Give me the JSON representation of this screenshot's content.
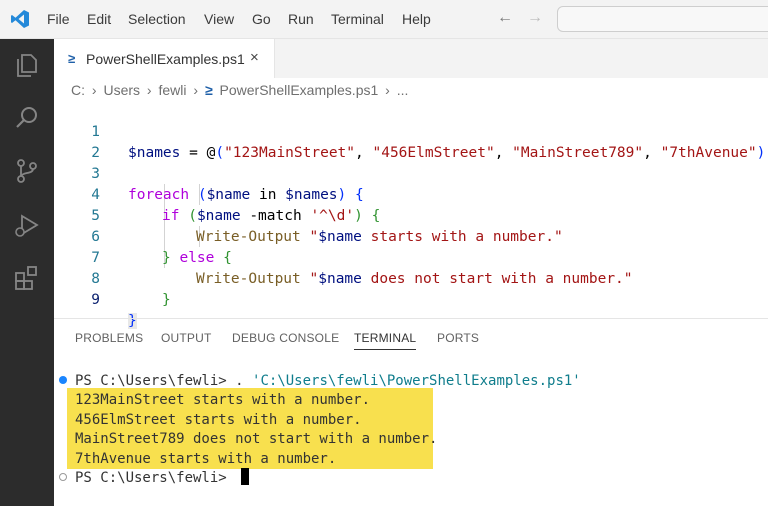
{
  "menu": [
    "File",
    "Edit",
    "Selection",
    "View",
    "Go",
    "Run",
    "Terminal",
    "Help"
  ],
  "tab": {
    "label": "PowerShellExamples.ps1",
    "close": "×",
    "ps_glyph": "≥"
  },
  "breadcrumb": [
    "C:",
    "Users",
    "fewli",
    "PowerShellExamples.ps1",
    "..."
  ],
  "line_numbers": [
    "1",
    "2",
    "3",
    "4",
    "5",
    "6",
    "7",
    "8",
    "9"
  ],
  "code": {
    "l1_var": "$names",
    "l1_eq": " = ",
    "l1_at": "@",
    "l1_open": "(",
    "l1_s1": "\"123MainStreet\"",
    "l1_s2": "\"456ElmStreet\"",
    "l1_s3": "\"MainStreet789\"",
    "l1_s4": "\"7thAvenue\"",
    "l1_comma": ", ",
    "l1_close": ")",
    "l3_kw": "foreach",
    "l3_open": " (",
    "l3_var1": "$name",
    "l3_in": " in ",
    "l3_var2": "$names",
    "l3_close": ") ",
    "l3_brace": "{",
    "l4_kw": "if",
    "l4_open": " (",
    "l4_var": "$name",
    "l4_op": " -match ",
    "l4_str": "'^\\d'",
    "l4_close": ") ",
    "l4_brace": "{",
    "l5_cmd": "Write-Output",
    "l5_q": " \"",
    "l5_var": "$name",
    "l5_rest": " starts with a number.\"",
    "l6_brace": "}",
    "l6_kw": " else ",
    "l6_brace2": "{",
    "l7_cmd": "Write-Output",
    "l7_q": " \"",
    "l7_var": "$name",
    "l7_rest": " does not start with a number.\"",
    "l8_brace": "}",
    "l9_brace": "}"
  },
  "panel_tabs": [
    "PROBLEMS",
    "OUTPUT",
    "DEBUG CONSOLE",
    "TERMINAL",
    "PORTS"
  ],
  "terminal": {
    "prompt1": "PS C:\\Users\\fewli> ",
    "cmd_dot": ". ",
    "cmd_path": "'C:\\Users\\fewli\\PowerShellExamples.ps1'",
    "output": [
      "123MainStreet starts with a number.",
      "456ElmStreet starts with a number.",
      "MainStreet789 does not start with a number.",
      "7thAvenue starts with a number."
    ],
    "prompt2": "PS C:\\Users\\fewli> "
  },
  "colors": {
    "highlight": "#f8e04e",
    "activity_bar": "#2c2c2c",
    "vscode_blue": "#2489d9"
  }
}
